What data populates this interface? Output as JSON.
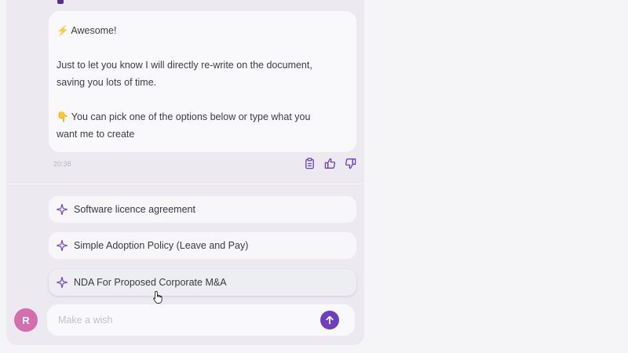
{
  "message": {
    "line1": "⚡ Awesome!",
    "line2": "Just to let you know I will directly re-write on the document,",
    "line3": "saving you lots of time.",
    "line4": "👇 You can pick one of the options below or type what you",
    "line5": "want me to create",
    "timestamp": "20:38"
  },
  "actions": {
    "copy_icon": "clipboard-icon",
    "like_icon": "thumbs-up-icon",
    "dislike_icon": "thumbs-down-icon"
  },
  "options": [
    {
      "label": "Software licence agreement"
    },
    {
      "label": "Simple Adoption Policy (Leave and Pay)"
    },
    {
      "label": "NDA For Proposed Corporate M&A"
    }
  ],
  "user": {
    "avatar_initial": "R",
    "avatar_color": "#d46fae"
  },
  "composer": {
    "placeholder": "Make a wish"
  },
  "colors": {
    "accent": "#6d3fc0",
    "marker": "#5a2d91"
  }
}
